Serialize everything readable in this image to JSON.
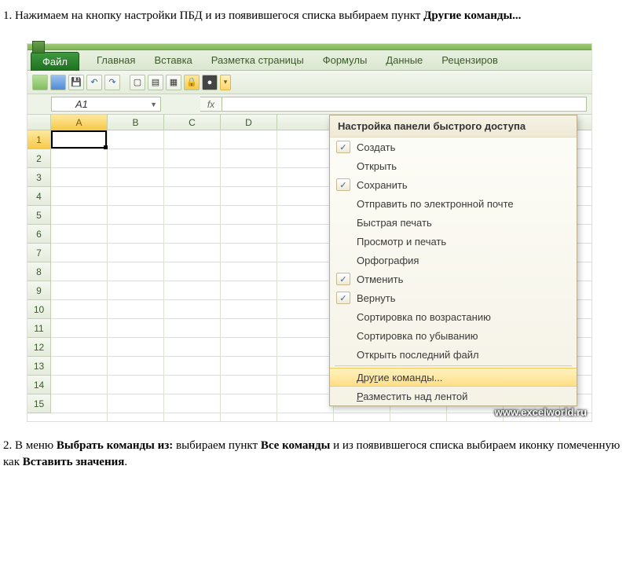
{
  "doc": {
    "step1_prefix": "1. Нажимаем на кнопку настройки ПБД и из появившегося списка выбираем пункт ",
    "step1_bold": "Другие команды...",
    "step2_p1": "2. В меню ",
    "step2_b1": "Выбрать команды из:",
    "step2_p2": " выбираем пункт ",
    "step2_b2": "Все команды",
    "step2_p3": " и из появившегося списка выбираем иконку помеченную как ",
    "step2_b3": "Вставить значения",
    "step2_p4": "."
  },
  "ribbon": {
    "file": "Файл",
    "tabs": [
      "Главная",
      "Вставка",
      "Разметка страницы",
      "Формулы",
      "Данные",
      "Рецензиров"
    ]
  },
  "qat_icons": [
    "excel-icon",
    "word-icon",
    "save-icon",
    "undo-icon",
    "redo-icon",
    "spacer",
    "doc-icon",
    "sheet-icon",
    "grid-icon",
    "lock-icon",
    "dark-icon"
  ],
  "namebox": "A1",
  "fx_label": "fx",
  "grid": {
    "cols": [
      "A",
      "B",
      "C",
      "D"
    ],
    "rows": [
      "1",
      "2",
      "3",
      "4",
      "5",
      "6",
      "7",
      "8",
      "9",
      "10",
      "11",
      "12",
      "13",
      "14",
      "15"
    ],
    "selected_cell": "A1"
  },
  "dropdown": {
    "title": "Настройка панели быстрого доступа",
    "items": [
      {
        "label": "Создать",
        "checked": true
      },
      {
        "label": "Открыть",
        "checked": false
      },
      {
        "label": "Сохранить",
        "checked": true
      },
      {
        "label": "Отправить по электронной почте",
        "checked": false
      },
      {
        "label": "Быстрая печать",
        "checked": false
      },
      {
        "label": "Просмотр и печать",
        "checked": false
      },
      {
        "label": "Орфография",
        "checked": false
      },
      {
        "label": "Отменить",
        "checked": true
      },
      {
        "label": "Вернуть",
        "checked": true
      },
      {
        "label": "Сортировка по возрастанию",
        "checked": false
      },
      {
        "label": "Сортировка по убыванию",
        "checked": false
      },
      {
        "label": "Открыть последний файл",
        "checked": false
      }
    ],
    "highlighted": {
      "pre": "Дру",
      "ul": "г",
      "post": "ие команды..."
    },
    "below": {
      "pre": "",
      "ul": "Р",
      "post": "азместить над лентой"
    }
  },
  "watermark": "www.excelworld.ru"
}
